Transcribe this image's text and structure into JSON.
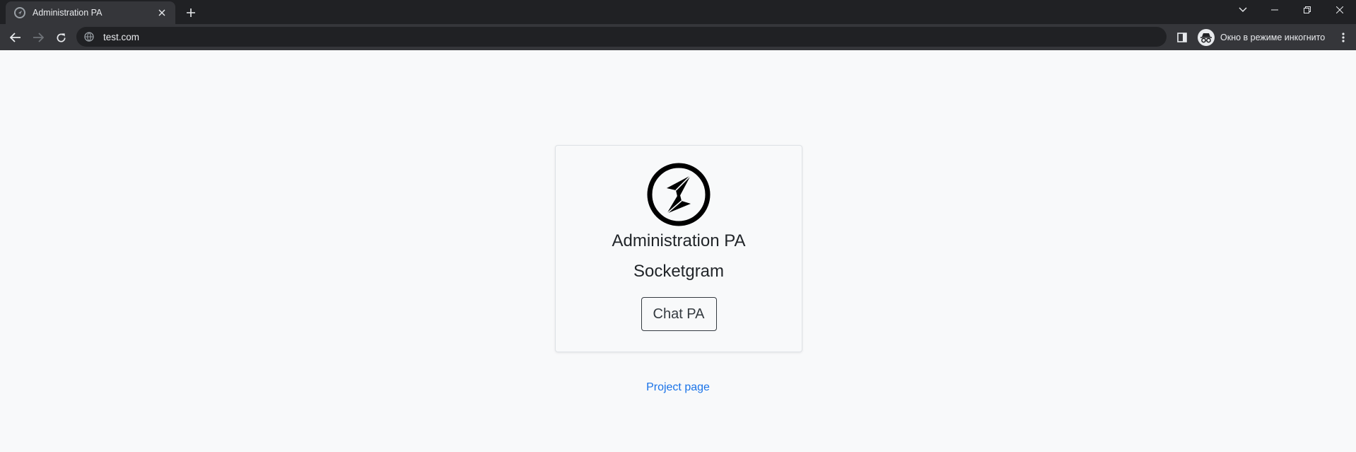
{
  "browser": {
    "tab_title": "Administration PA",
    "url": "test.com",
    "incognito_label": "Окно в режиме инкогнито",
    "icons": {
      "favicon": "socketgram-favicon-icon",
      "tab_close": "close-icon",
      "new_tab": "plus-icon",
      "tab_search": "chevron-down-icon",
      "minimize": "minimize-icon",
      "restore": "restore-icon",
      "close_window": "close-icon",
      "back": "arrow-left-icon",
      "forward": "arrow-right-icon",
      "reload": "reload-icon",
      "site_info": "globe-icon",
      "side_panel": "side-panel-icon",
      "incognito": "incognito-icon",
      "menu": "kebab-menu-icon"
    }
  },
  "page": {
    "card": {
      "logo_icon": "socketgram-logo-icon",
      "title": "Administration PA",
      "subtitle": "Socketgram",
      "button_label": "Chat PA"
    },
    "link_label": "Project page"
  },
  "colors": {
    "chrome_dark": "#202124",
    "chrome_toolbar": "#35363a",
    "page_background": "#f8f9fa",
    "link": "#1a73e8",
    "text": "#212529"
  }
}
